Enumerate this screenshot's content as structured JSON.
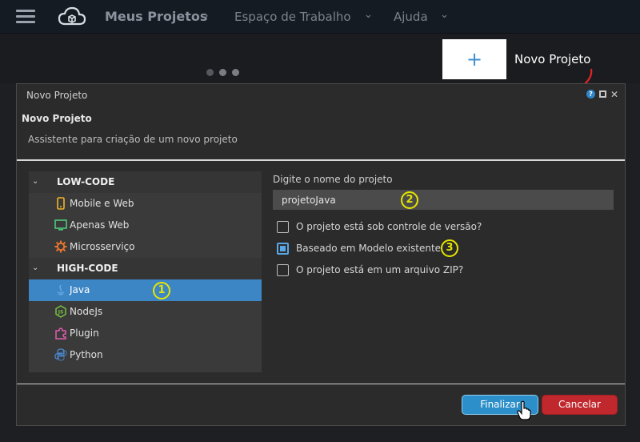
{
  "nav": {
    "title": "Meus Projetos",
    "separator": "›",
    "workspace": "Espaço de Trabalho",
    "help": "Ajuda",
    "chevron": "⌄"
  },
  "banner": {
    "new_project_plus": "+",
    "new_project_label": "Novo Projeto"
  },
  "dialog": {
    "window_title": "Novo Projeto",
    "help_glyph": "?",
    "close_glyph": "✕",
    "heading": "Novo Projeto",
    "description": "Assistente para criação de um novo projeto",
    "tree": {
      "groups": [
        {
          "label": "LOW-CODE",
          "items": [
            {
              "label": "Mobile e Web",
              "icon": "mobile-icon"
            },
            {
              "label": "Apenas Web",
              "icon": "monitor-icon"
            },
            {
              "label": "Microsserviço",
              "icon": "gear-icon"
            }
          ]
        },
        {
          "label": "HIGH-CODE",
          "items": [
            {
              "label": "Java",
              "icon": "java-icon",
              "selected": true
            },
            {
              "label": "NodeJs",
              "icon": "nodejs-icon"
            },
            {
              "label": "Plugin",
              "icon": "puzzle-icon"
            },
            {
              "label": "Python",
              "icon": "python-icon"
            }
          ]
        }
      ]
    },
    "form": {
      "name_label": "Digite o nome do projeto",
      "name_value": "projetoJava",
      "options": [
        {
          "label": "O projeto está sob controle de versão?",
          "checked": false
        },
        {
          "label": "Baseado em Modelo existente",
          "checked": true
        },
        {
          "label": "O projeto está em um arquivo ZIP?",
          "checked": false
        }
      ]
    },
    "buttons": {
      "finish": "Finalizar",
      "cancel": "Cancelar"
    },
    "callouts": [
      "1",
      "2",
      "3"
    ]
  },
  "colors": {
    "accent": "#3d86c6",
    "danger": "#c0282d",
    "callout": "#e6e600",
    "arrow": "#e02424"
  }
}
